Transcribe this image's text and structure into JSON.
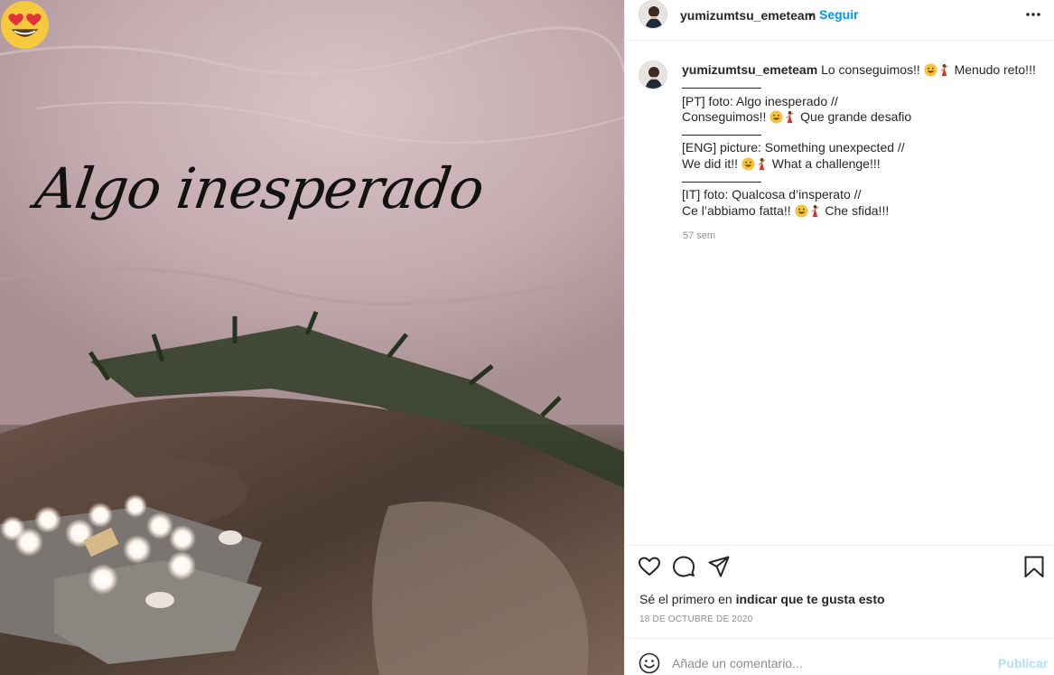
{
  "post": {
    "username": "yumizumtsu_emeteam",
    "dot": "•",
    "follow_label": "Seguir",
    "overlay_text": "Algo inesperado",
    "caption_lines": [
      "Lo conseguimos!!",
      "Menudo reto!!!",
      "[PT] foto: Algo inesperado //",
      "Conseguimos!!",
      "Que grande desafio",
      "[ENG] picture: Something unexpected //",
      "We did it!!",
      "What a challenge!!!",
      "[IT] foto: Qualcosa d’insperato //",
      "Ce l’abbiamo fatta!!",
      "Che sfida!!!"
    ],
    "time_ago": "57 sem",
    "likes_prefix": "Sé el primero en ",
    "likes_link": "indicar que te gusta esto",
    "date": "18 DE OCTUBRE DE 2020",
    "comment_placeholder": "Añade un comentario...",
    "publish_label": "Publicar"
  },
  "icons": {
    "overlay": "heart-eyes-emoji",
    "caption": [
      "grinning-face-emoji",
      "dancer-emoji"
    ],
    "actions": [
      "heart-icon",
      "comment-icon",
      "share-icon",
      "bookmark-icon"
    ],
    "header": "more-options-icon",
    "comment": "smiley-icon"
  },
  "colors": {
    "accent": "#0095f6",
    "publish_disabled": "#b2dffc",
    "muted": "#8e8e8e",
    "text": "#262626",
    "border": "#efefef"
  }
}
